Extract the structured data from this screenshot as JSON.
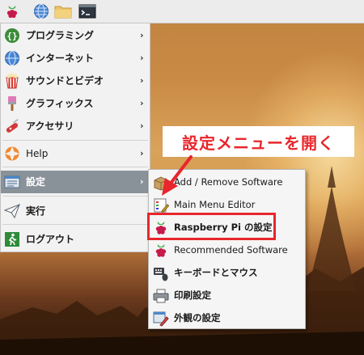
{
  "main_menu": {
    "items": [
      {
        "label": "プログラミング",
        "icon": "code-braces-icon",
        "has_submenu": true
      },
      {
        "label": "インターネット",
        "icon": "globe-icon",
        "has_submenu": true
      },
      {
        "label": "サウンドとビデオ",
        "icon": "popcorn-icon",
        "has_submenu": true
      },
      {
        "label": "グラフィックス",
        "icon": "paintbrush-icon",
        "has_submenu": true
      },
      {
        "label": "アクセサリ",
        "icon": "swiss-knife-icon",
        "has_submenu": true
      },
      {
        "label": "Help",
        "icon": "lifebuoy-icon",
        "has_submenu": true
      },
      {
        "label": "設定",
        "icon": "settings-panel-icon",
        "has_submenu": true,
        "highlighted": true
      },
      {
        "label": "実行",
        "icon": "paper-plane-icon",
        "has_submenu": false
      },
      {
        "label": "ログアウト",
        "icon": "exit-running-man-icon",
        "has_submenu": false
      }
    ],
    "arrow_glyph": "›"
  },
  "submenu": {
    "items": [
      {
        "label": "Add / Remove Software",
        "icon": "package-box-icon"
      },
      {
        "label": "Main Menu Editor",
        "icon": "menu-editor-icon"
      },
      {
        "label": "Raspberry Pi の設定",
        "icon": "raspberry-icon"
      },
      {
        "label": "Recommended Software",
        "icon": "raspberry-icon"
      },
      {
        "label": "キーボードとマウス",
        "icon": "keyboard-mouse-icon"
      },
      {
        "label": "印刷設定",
        "icon": "printer-icon"
      },
      {
        "label": "外観の設定",
        "icon": "appearance-palette-icon"
      }
    ]
  },
  "annotation": {
    "callout_text": "設定メニューを開く",
    "color": "#e8262c"
  },
  "colors": {
    "highlight": "#8a9299",
    "menu_bg": "#f2f2f2",
    "panel_bg": "#ececec"
  }
}
